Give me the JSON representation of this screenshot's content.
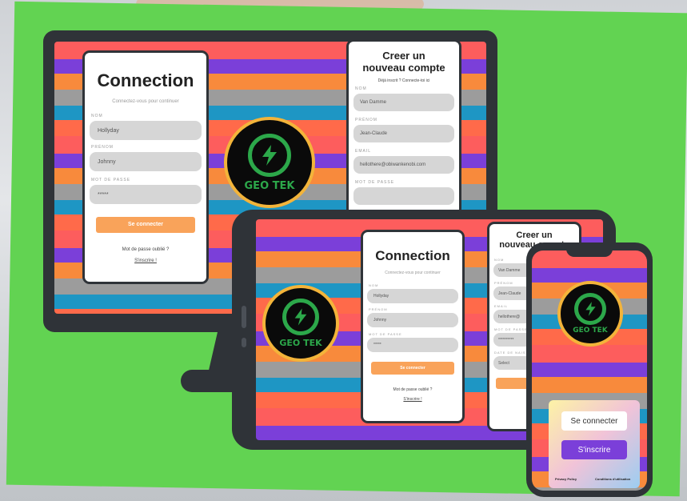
{
  "desktop": {
    "login": {
      "title": "Connection",
      "subtitle": "Connectez-vous pour continuer",
      "username_label": "NOM",
      "username_value": "Hollyday",
      "firstname_label": "PRÉNOM",
      "firstname_value": "Johnny",
      "password_label": "MOT DE PASSE",
      "password_value": "*****",
      "submit_label": "Se connecter",
      "forgot_label": "Mot de passe oublié ?",
      "signup_link": "S'inscrire !"
    },
    "register": {
      "title_line1": "Creer un",
      "title_line2": "nouveau compte",
      "already_label": "Déjà inscrit ? Connecte-toi ici",
      "name_label": "NOM",
      "name_value": "Van Damme",
      "firstname_label": "PRÉNOM",
      "firstname_value": "Jean-Claude",
      "email_label": "EMAIL",
      "email_value": "hellothere@obiwankenobi.com",
      "password_label": "MOT DE PASSE"
    },
    "logo_text": "GEO TEK"
  },
  "tablet": {
    "login": {
      "title": "Connection",
      "subtitle": "Connectez-vous pour continuer",
      "username_label": "NOM",
      "username_value": "Hollyday",
      "firstname_label": "PRÉNOM",
      "firstname_value": "Johnny",
      "password_label": "MOT DE PASSE",
      "password_value": "*****",
      "submit_label": "Se connecter",
      "forgot_label": "Mot de passe oublié ?",
      "signup_link": "S'inscrire !"
    },
    "register": {
      "title_line1": "Creer un",
      "title_line2": "nouveau compte",
      "name_label": "NOM",
      "name_value": "Van Damme",
      "firstname_label": "PRÉNOM",
      "firstname_value": "Jean-Claude",
      "email_label": "EMAIL",
      "email_value": "hellothere@",
      "password_label": "MOT DE PASSE",
      "password_value": "**********",
      "birth_label": "DATE DE NAISSANCE",
      "birth_value": "Select"
    },
    "logo_text": "GEO TEK"
  },
  "phone": {
    "logo_text": "GEO TEK",
    "login_button": "Se connecter",
    "signup_button": "S'inscrire",
    "privacy_link": "Privacy Policy",
    "terms_link": "Conditions d'utilisation"
  },
  "colors": {
    "background": "#62d352",
    "device": "#2f3338",
    "accent_orange": "#f9a35a",
    "accent_purple": "#7b3fd9",
    "logo_green": "#2ca84a",
    "logo_ring": "#f3b43a"
  }
}
